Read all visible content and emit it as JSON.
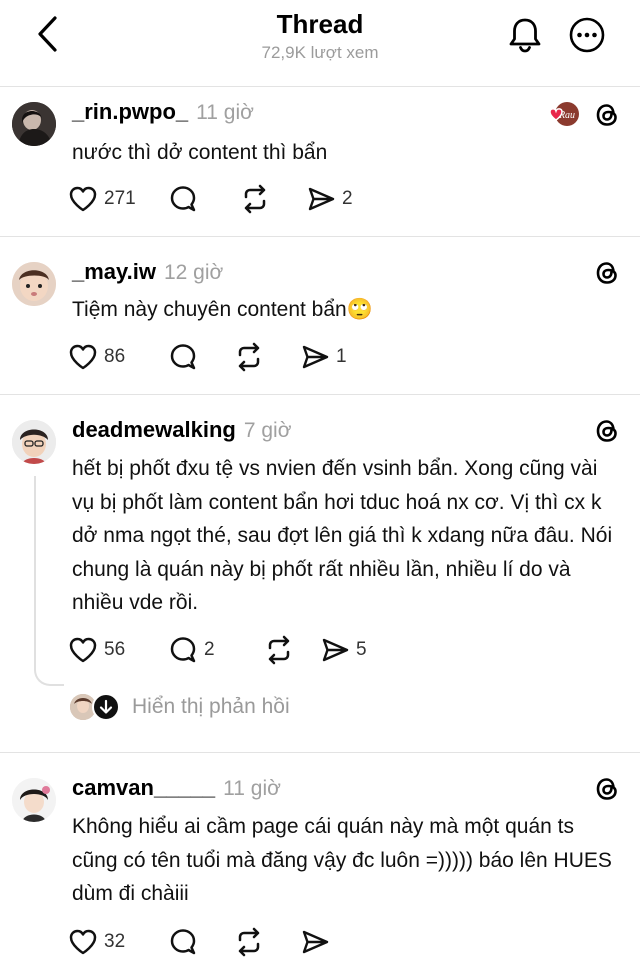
{
  "header": {
    "title": "Thread",
    "views": "72,9K lượt xem"
  },
  "posts": [
    {
      "username": "_rin.pwpo_",
      "time": "11 giờ",
      "content": "nước thì dở content thì bẩn",
      "likes": "271",
      "comments": "",
      "shares": "2",
      "badge": "Rau"
    },
    {
      "username": "_may.iw",
      "time": "12 giờ",
      "content": "Tiệm này chuyên content bẩn",
      "emoji": "🙄",
      "likes": "86",
      "comments": "",
      "shares": "1"
    },
    {
      "username": "deadmewalking",
      "time": "7 giờ",
      "content": "hết bị phốt đxu tệ vs nvien đến vsinh bẩn. Xong cũng vài vụ bị phốt làm content bẩn hơi tduc hoá nx cơ. Vị thì cx k dở nma ngọt thé, sau đợt lên giá thì k xdang nữa đâu. Nói chung là quán này bị phốt rất nhiều lần, nhiều lí do và nhiều vde rồi.",
      "likes": "56",
      "comments": "2",
      "shares": "5",
      "show_replies": "Hiển thị phản hồi"
    },
    {
      "username": "camvan_____",
      "time": "11 giờ",
      "content": "Không hiểu ai cầm page cái quán này mà một quán ts cũng có tên tuổi mà đăng vậy đc luôn =))))) báo lên HUES dùm đi chàiii",
      "likes": "32",
      "comments": "",
      "shares": ""
    }
  ],
  "icons": {
    "back": "chevron-left-icon",
    "bell": "bell-icon",
    "more": "more-icon",
    "like": "heart-icon",
    "comment": "comment-icon",
    "repost": "repost-icon",
    "share": "send-icon",
    "threads": "threads-logo-icon"
  },
  "colors": {
    "muted": "#9b9b9b",
    "divider": "#e3e3e3",
    "badge_heart": "#e8264a"
  }
}
